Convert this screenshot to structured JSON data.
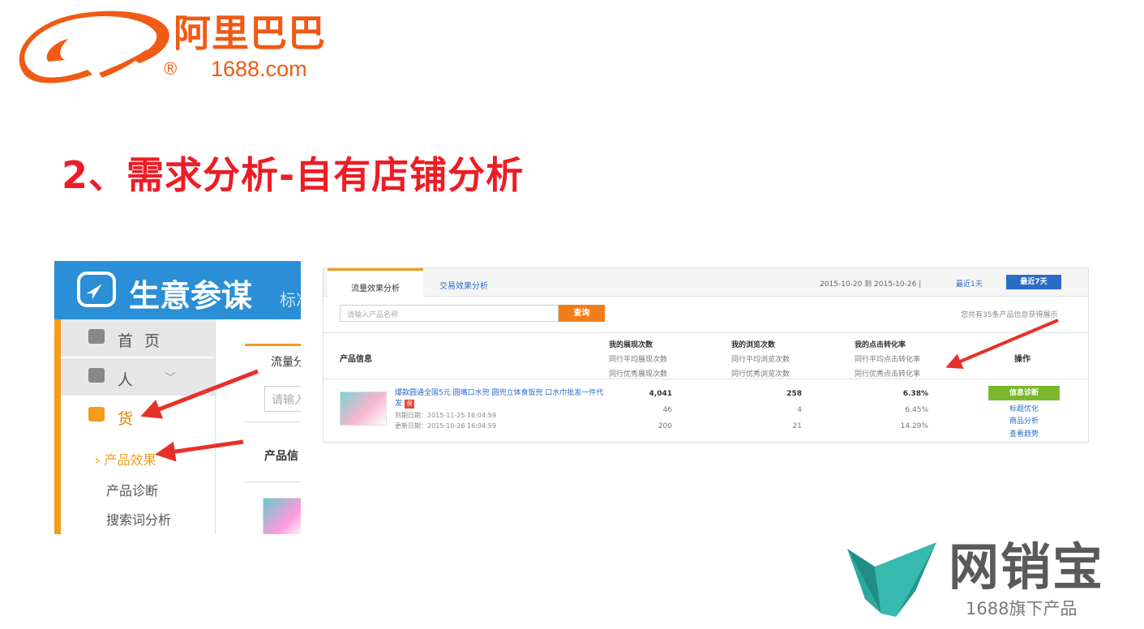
{
  "logo": {
    "name_cn": "阿里巴巴",
    "registered": "®",
    "domain": "1688.com"
  },
  "slide": {
    "title": "2、需求分析-自有店铺分析"
  },
  "left_screenshot": {
    "brand": "生意参谋",
    "brand_suffix": "标准",
    "nav": [
      {
        "label": "首页",
        "icon": "home-icon"
      },
      {
        "label": "人",
        "icon": "person-icon",
        "chevron": "﹀"
      },
      {
        "label": "货",
        "icon": "bag-icon"
      }
    ],
    "subnav": {
      "active_marker": "›",
      "items": [
        "产品效果",
        "产品诊断",
        "搜索词分析"
      ]
    },
    "main": {
      "tab": "流量分",
      "input_placeholder": "请输入",
      "column": "产品信"
    }
  },
  "right_screenshot": {
    "tabs": [
      "流量效果分析",
      "交易效果分析"
    ],
    "date_range": "2015-10-20 到 2015-10-26 |",
    "link_1day": "最近1天",
    "btn_7day": "最近7天",
    "search_placeholder": "请输入产品名称",
    "search_button": "查询",
    "count_note": "您共有35条产品信息获得展示",
    "columns": {
      "info": "产品信息",
      "exposure": {
        "main": "我的展现次数",
        "sub1": "同行平均展现次数",
        "sub2": "同行优秀展现次数"
      },
      "views": {
        "main": "我的浏览次数",
        "sub1": "同行平均浏览次数",
        "sub2": "同行优秀浏览次数"
      },
      "ctr": {
        "main": "我的点击转化率",
        "sub1": "同行平均点击转化率",
        "sub2": "同行优秀点击转化率"
      },
      "ops": "操作"
    },
    "row": {
      "title": "爆款圆通全国5元 圆嘴口水兜 圆兜立体食饭兜 口水巾批发一件代发",
      "badge": "保",
      "date1": "到期日期：2015-11-25 16:04:59",
      "date2": "更新日期：2015-10-26 16:04:59",
      "exposure": [
        "4,041",
        "46",
        "200"
      ],
      "views": [
        "258",
        "4",
        "21"
      ],
      "ctr": [
        "6.38%",
        "6.45%",
        "14.29%"
      ],
      "ops": {
        "diagnose": "信息诊断",
        "title_opt": "标题优化",
        "product_analysis": "商品分析",
        "trend": "查看趋势"
      }
    }
  },
  "brand_logo": {
    "name": "网销宝",
    "sub": "1688旗下产品"
  },
  "colors": {
    "title_red": "#ee1c25",
    "alibaba_orange": "#f05a14",
    "header_blue": "#2a8fd6",
    "accent_orange": "#f39c1e",
    "link_blue": "#2b6cc4",
    "diag_green": "#7ab92e",
    "arrow_red": "#e8302a",
    "brand_teal": "#2aa9a0"
  }
}
